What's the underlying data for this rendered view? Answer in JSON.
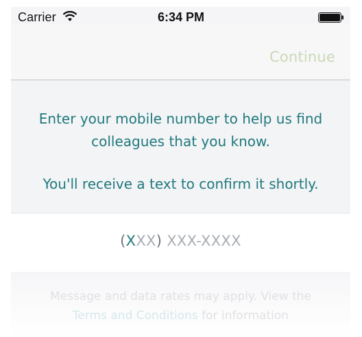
{
  "status_bar": {
    "carrier": "Carrier",
    "time": "6:34 PM",
    "icons": [
      "wifi-icon",
      "battery-icon"
    ]
  },
  "nav": {
    "continue_label": "Continue"
  },
  "info": {
    "line1": "Enter your mobile number to help us find colleagues that you know.",
    "line2": "You'll receive a text to confirm it shortly."
  },
  "phone": {
    "open_paren": "(",
    "first_char": "X",
    "area_rest": "XX",
    "close_paren": ")",
    "rest": " XXX-XXXX"
  },
  "disclaimer": {
    "text_before": "Message and data rates may apply. View the",
    "link": "Terms and Conditions",
    "text_after": " for information"
  },
  "colors": {
    "accent": "#20787c",
    "continue_disabled": "#c9d9b8",
    "panel_bg": "#f3f4f6"
  }
}
